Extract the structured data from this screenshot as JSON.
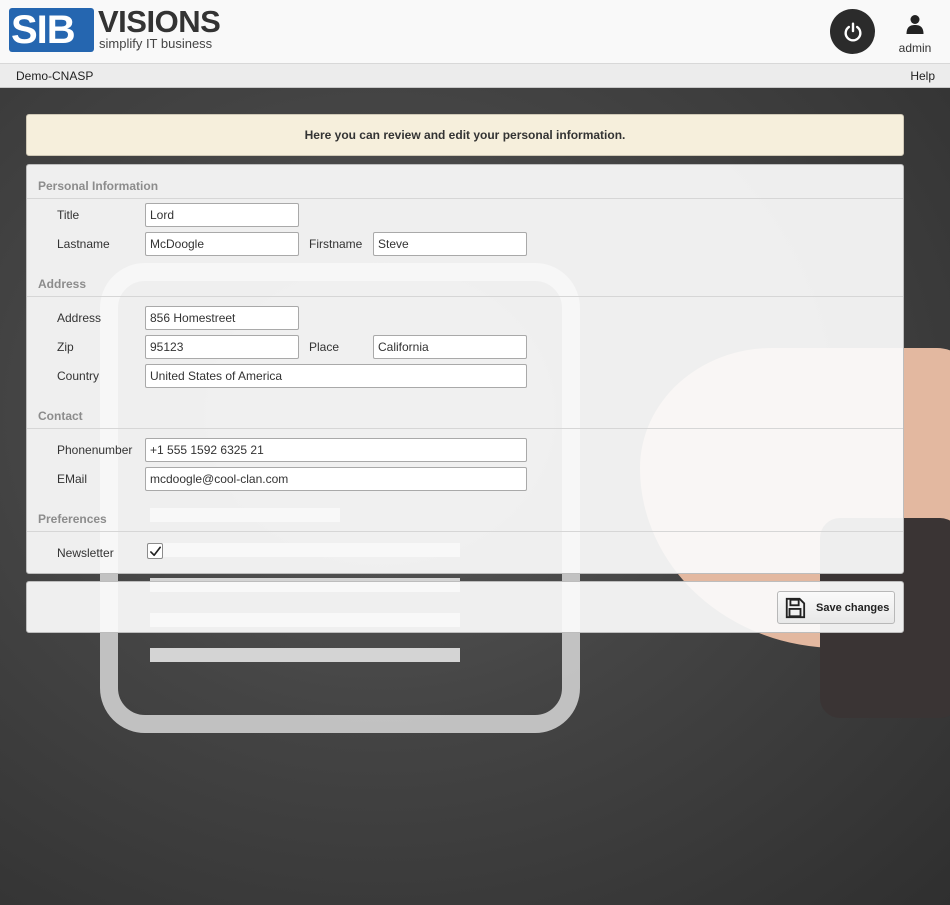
{
  "header": {
    "logo_mark": "SIB",
    "logo_word": "VISIONS",
    "logo_tagline": "simplify IT business",
    "user_label": "admin"
  },
  "menubar": {
    "app_name": "Demo-CNASP",
    "help_label": "Help"
  },
  "info_message": "Here you can review and edit your personal information.",
  "sections": {
    "personal": {
      "title": "Personal Information",
      "title_label": "Title",
      "title_value": "Lord",
      "lastname_label": "Lastname",
      "lastname_value": "McDoogle",
      "firstname_label": "Firstname",
      "firstname_value": "Steve"
    },
    "address": {
      "title": "Address",
      "address_label": "Address",
      "address_value": "856 Homestreet",
      "zip_label": "Zip",
      "zip_value": "95123",
      "place_label": "Place",
      "place_value": "California",
      "country_label": "Country",
      "country_value": "United States of America"
    },
    "contact": {
      "title": "Contact",
      "phone_label": "Phonenumber",
      "phone_value": "+1 555 1592 6325 21",
      "email_label": "EMail",
      "email_value": "mcdoogle@cool-clan.com"
    },
    "preferences": {
      "title": "Preferences",
      "newsletter_label": "Newsletter",
      "newsletter_checked": true
    }
  },
  "actions": {
    "save_label": "Save changes"
  },
  "colors": {
    "brand_blue": "#2566b0",
    "info_bg": "#f6efdc",
    "section_title": "#8c8c8c"
  },
  "icons": {
    "power": "power-icon",
    "user": "user-icon",
    "save": "floppy-disk-icon",
    "check": "checkmark-icon"
  }
}
